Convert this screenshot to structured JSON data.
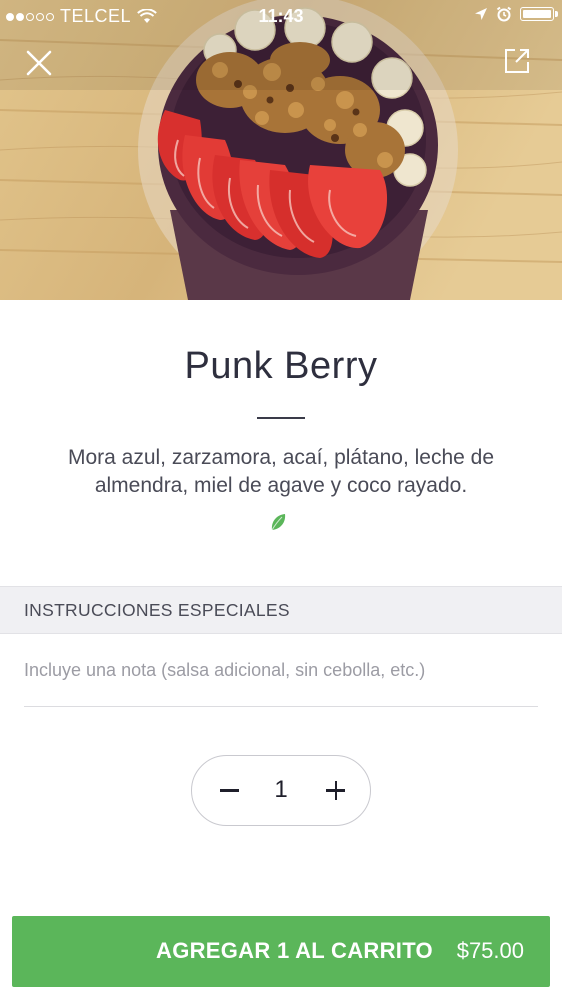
{
  "status_bar": {
    "carrier": "TELCEL",
    "time": "11:43"
  },
  "product": {
    "title": "Punk Berry",
    "description": "Mora azul, zarzamora, acaí, plátano, leche de almendra, miel de agave y coco rayado.",
    "diet_icon": "leaf-icon",
    "diet_icon_color": "#5bb65a"
  },
  "special_instructions": {
    "header": "INSTRUCCIONES ESPECIALES",
    "placeholder": "Incluye una nota (salsa adicional, sin cebolla, etc.)",
    "value": ""
  },
  "quantity": {
    "value": "1",
    "decrement_icon": "minus-icon",
    "increment_icon": "plus-icon"
  },
  "cart_button": {
    "label": "AGREGAR 1 AL CARRITO",
    "price": "$75.00",
    "color": "#5bb65a"
  }
}
